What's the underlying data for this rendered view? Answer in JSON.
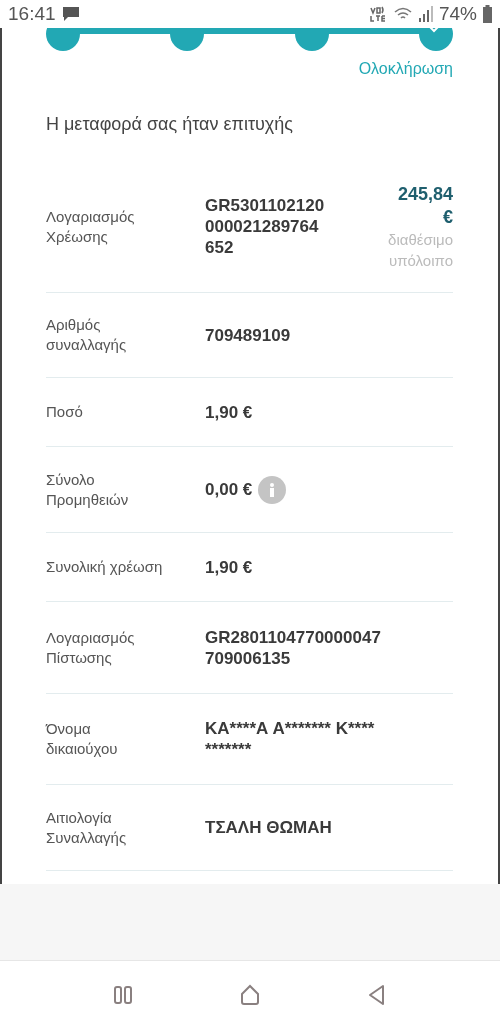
{
  "status_bar": {
    "time": "16:41",
    "battery": "74%"
  },
  "stepper": {
    "steps": [
      {
        "kind": "dot"
      },
      {
        "kind": "dot"
      },
      {
        "kind": "dot"
      },
      {
        "kind": "check"
      }
    ],
    "current_label": "Ολοκλήρωση"
  },
  "title": "Η μεταφορά σας ήταν επιτυχής",
  "rows": [
    {
      "kind": "balance",
      "label": "Λογαριασμός Χρέωσης",
      "value": "GR5301102120 000021289764 652",
      "amount": "245,84 €",
      "amount_caption": "διαθέσιμο υπόλοιπο"
    },
    {
      "kind": "plain",
      "label": "Αριθμός συναλλαγής",
      "value": "709489109"
    },
    {
      "kind": "plain",
      "label": "Ποσό",
      "value": "1,90 €"
    },
    {
      "kind": "info",
      "label": "Σύνολο Προμηθειών",
      "value": "0,00 €"
    },
    {
      "kind": "plain",
      "label": "Συνολική χρέωση",
      "value": "1,90 €"
    },
    {
      "kind": "plain",
      "label": "Λογαριασμός Πίστωσης",
      "value": "GR2801104770000047 709006135"
    },
    {
      "kind": "plain",
      "label": "Όνομα δικαιούχου",
      "value": "ΚΑ****Α Α******* Κ**** *******"
    },
    {
      "kind": "plain",
      "label": "Αιτιολογία Συναλλαγής",
      "value": "ΤΣΑΛΗ ΘΩΜΑΗ"
    }
  ]
}
